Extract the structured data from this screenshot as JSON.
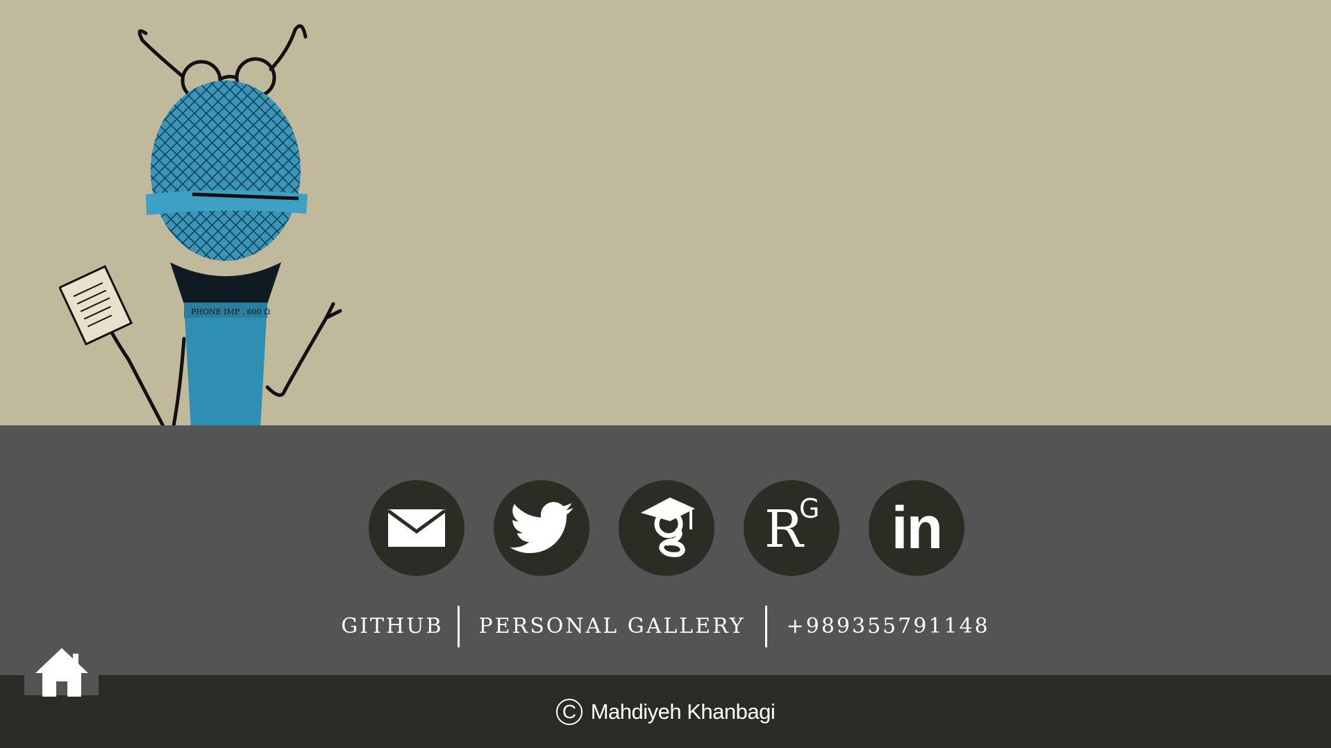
{
  "colors": {
    "hero_background": "#c1b99b",
    "contact_background": "#545454",
    "footer_background": "#2a2b24",
    "icon_circle": "#2b2c24",
    "microphone": "#2f8fb3"
  },
  "illustration": {
    "mic_label_text": "PHONE   IMP . 600 Ω"
  },
  "social": [
    {
      "name": "email",
      "icon": "envelope-icon"
    },
    {
      "name": "twitter",
      "icon": "twitter-bird-icon"
    },
    {
      "name": "google-scholar",
      "icon": "google-scholar-icon"
    },
    {
      "name": "researchgate",
      "icon": "researchgate-icon",
      "text": "R",
      "superscript": "G"
    },
    {
      "name": "linkedin",
      "icon": "linkedin-icon",
      "text": "in"
    }
  ],
  "links": {
    "github": "GITHUB",
    "gallery": "PERSONAL GALLERY",
    "phone": "+989355791148"
  },
  "footer": {
    "copyright_symbol": "C",
    "copyright_text": "Mahdiyeh Khanbagi"
  },
  "home": {
    "icon": "home-icon"
  }
}
